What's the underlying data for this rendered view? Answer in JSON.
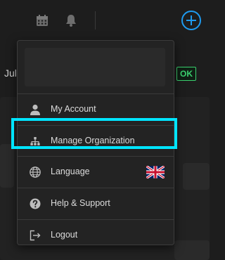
{
  "topbar": {
    "icons": [
      "calendar-icon",
      "bell-icon",
      "plus-circle-icon"
    ],
    "accent_color": "#1e9bf0"
  },
  "background": {
    "partial_text": "Jul",
    "status_badge": "OK",
    "badge_color": "#3bd16f"
  },
  "menu": {
    "items": [
      {
        "label": "My Account",
        "icon": "user-icon"
      },
      {
        "label": "Manage Organization",
        "icon": "org-chart-icon"
      },
      {
        "label": "Language",
        "icon": "globe-icon",
        "flag": "uk-flag-icon"
      },
      {
        "label": "Help & Support",
        "icon": "help-circle-icon"
      },
      {
        "label": "Logout",
        "icon": "logout-icon"
      }
    ],
    "highlighted_item": "Manage Organization",
    "highlight_color": "#00e5ff"
  }
}
